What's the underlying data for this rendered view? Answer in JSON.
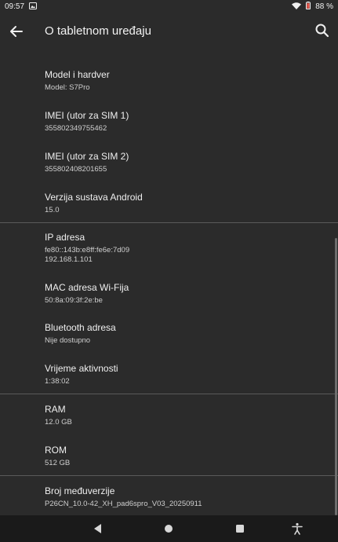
{
  "status": {
    "time": "09:57",
    "battery": "88 %"
  },
  "header": {
    "title": "O tabletnom uređaju"
  },
  "icons": {
    "back": "arrow-left-icon",
    "search": "search-icon",
    "wifi": "wifi-icon",
    "battery": "battery-icon",
    "gallery": "image-notification-icon"
  },
  "items": [
    {
      "title": "Model i hardver",
      "value": "Model: S7Pro"
    },
    {
      "title": "IMEI (utor za SIM 1)",
      "value": "355802349755462"
    },
    {
      "title": "IMEI (utor za SIM 2)",
      "value": "355802408201655"
    },
    {
      "title": "Verzija sustava Android",
      "value": "15.0"
    },
    {
      "title": "IP adresa",
      "value": "fe80::143b:e8ff:fe6e:7d09",
      "value2": "192.168.1.101"
    },
    {
      "title": "MAC adresa Wi-Fija",
      "value": "50:8a:09:3f:2e:be"
    },
    {
      "title": "Bluetooth adresa",
      "value": "Nije dostupno"
    },
    {
      "title": "Vrijeme aktivnosti",
      "value": "1:38:02"
    },
    {
      "title": "RAM",
      "value": "12.0 GB"
    },
    {
      "title": "ROM",
      "value": "512 GB"
    },
    {
      "title": "Broj međuverzije",
      "value": "P26CN_10.0-42_XH_pad6spro_V03_20250911"
    }
  ]
}
